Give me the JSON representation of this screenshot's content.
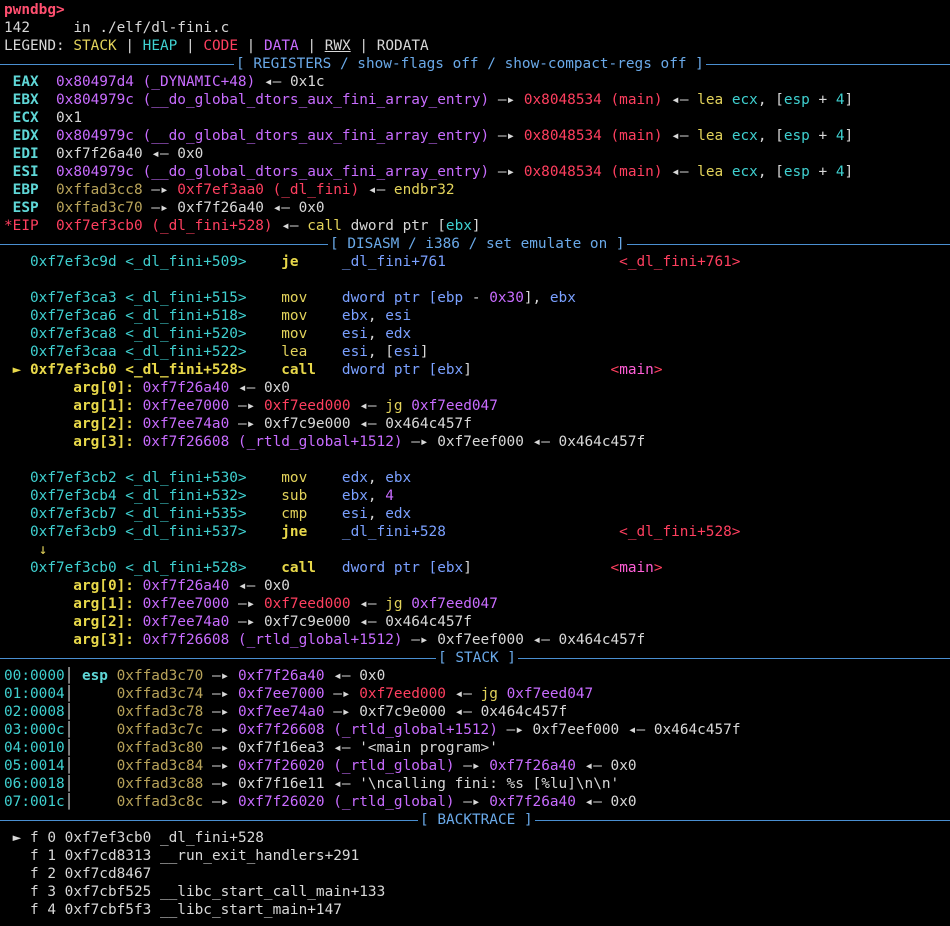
{
  "prompt": "pwndbg>",
  "source_line": {
    "num": "142",
    "text": "in ./elf/dl-fini.c"
  },
  "legend": {
    "label": "LEGEND:",
    "items": [
      {
        "text": "STACK",
        "color": "#e3d35b"
      },
      {
        "text": "HEAP",
        "color": "#3fd0d0"
      },
      {
        "text": "CODE",
        "color": "#ff3f5f"
      },
      {
        "text": "DATA",
        "color": "#c86cff"
      },
      {
        "text": "RWX",
        "color": "#d8d8d8"
      },
      {
        "text": "RODATA",
        "color": "#d8d8d8"
      }
    ]
  },
  "sections": {
    "registers": "[ REGISTERS / show-flags off / show-compact-regs off ]",
    "disasm": "[ DISASM / i386 / set emulate on ]",
    "stack": "[ STACK ]",
    "backtrace": "[ BACKTRACE ]"
  },
  "registers": [
    [
      {
        "t": " EAX ",
        "c": "reg"
      },
      {
        "t": " 0x80497d4 (_DYNAMIC+48) ",
        "c": "purple"
      },
      {
        "t": "◂— ",
        "c": "white"
      },
      {
        "t": "0x1c",
        "c": "white"
      }
    ],
    [
      {
        "t": " EBX ",
        "c": "reg"
      },
      {
        "t": " 0x804979c (__do_global_dtors_aux_fini_array_entry) ",
        "c": "purple"
      },
      {
        "t": "—▸ ",
        "c": "white"
      },
      {
        "t": "0x8048534 (main) ",
        "c": "red"
      },
      {
        "t": "◂— ",
        "c": "white"
      },
      {
        "t": "lea ",
        "c": "yellow"
      },
      {
        "t": "ecx",
        "c": "cyan"
      },
      {
        "t": ", [",
        "c": "white"
      },
      {
        "t": "esp",
        "c": "cyan"
      },
      {
        "t": " + ",
        "c": "white"
      },
      {
        "t": "4",
        "c": "cyan"
      },
      {
        "t": "]",
        "c": "white"
      }
    ],
    [
      {
        "t": " ECX ",
        "c": "reg"
      },
      {
        "t": " 0x1",
        "c": "white"
      }
    ],
    [
      {
        "t": " EDX ",
        "c": "reg"
      },
      {
        "t": " 0x804979c (__do_global_dtors_aux_fini_array_entry) ",
        "c": "purple"
      },
      {
        "t": "—▸ ",
        "c": "white"
      },
      {
        "t": "0x8048534 (main) ",
        "c": "red"
      },
      {
        "t": "◂— ",
        "c": "white"
      },
      {
        "t": "lea ",
        "c": "yellow"
      },
      {
        "t": "ecx",
        "c": "cyan"
      },
      {
        "t": ", [",
        "c": "white"
      },
      {
        "t": "esp",
        "c": "cyan"
      },
      {
        "t": " + ",
        "c": "white"
      },
      {
        "t": "4",
        "c": "cyan"
      },
      {
        "t": "]",
        "c": "white"
      }
    ],
    [
      {
        "t": " EDI ",
        "c": "reg"
      },
      {
        "t": " 0xf7f26a40 ",
        "c": "white"
      },
      {
        "t": "◂— ",
        "c": "white"
      },
      {
        "t": "0x0",
        "c": "white"
      }
    ],
    [
      {
        "t": " ESI ",
        "c": "reg"
      },
      {
        "t": " 0x804979c (__do_global_dtors_aux_fini_array_entry) ",
        "c": "purple"
      },
      {
        "t": "—▸ ",
        "c": "white"
      },
      {
        "t": "0x8048534 (main) ",
        "c": "red"
      },
      {
        "t": "◂— ",
        "c": "white"
      },
      {
        "t": "lea ",
        "c": "yellow"
      },
      {
        "t": "ecx",
        "c": "cyan"
      },
      {
        "t": ", [",
        "c": "white"
      },
      {
        "t": "esp",
        "c": "cyan"
      },
      {
        "t": " + ",
        "c": "white"
      },
      {
        "t": "4",
        "c": "cyan"
      },
      {
        "t": "]",
        "c": "white"
      }
    ],
    [
      {
        "t": " EBP ",
        "c": "reg"
      },
      {
        "t": " 0xffad3cc8 ",
        "c": "brown"
      },
      {
        "t": "—▸ ",
        "c": "white"
      },
      {
        "t": "0xf7ef3aa0 (_dl_fini) ",
        "c": "red"
      },
      {
        "t": "◂— ",
        "c": "white"
      },
      {
        "t": "endbr32",
        "c": "yellow"
      }
    ],
    [
      {
        "t": " ESP ",
        "c": "reg"
      },
      {
        "t": " 0xffad3c70 ",
        "c": "brown"
      },
      {
        "t": "—▸ ",
        "c": "white"
      },
      {
        "t": "0xf7f26a40 ",
        "c": "white"
      },
      {
        "t": "◂— ",
        "c": "white"
      },
      {
        "t": "0x0",
        "c": "white"
      }
    ],
    [
      {
        "t": "*EIP ",
        "c": "red"
      },
      {
        "t": " 0xf7ef3cb0 (_dl_fini+528) ",
        "c": "red"
      },
      {
        "t": "◂— ",
        "c": "white"
      },
      {
        "t": "call ",
        "c": "yellow"
      },
      {
        "t": "dword ptr [",
        "c": "white"
      },
      {
        "t": "ebx",
        "c": "cyan"
      },
      {
        "t": "]",
        "c": "white"
      }
    ]
  ],
  "disasm": [
    [
      {
        "t": "   0xf7ef3c9d <_dl_fini+509>    ",
        "c": "cyan"
      },
      {
        "t": "je     ",
        "c": "ybold"
      },
      {
        "t": "_dl_fini+761",
        "c": "blue"
      },
      {
        "t": "                    ",
        "c": "white"
      },
      {
        "t": "<_dl_fini+761>",
        "c": "red"
      }
    ],
    [],
    [
      {
        "t": "   0xf7ef3ca3 <_dl_fini+515>    ",
        "c": "cyan"
      },
      {
        "t": "mov    ",
        "c": "yellow"
      },
      {
        "t": "dword ptr [",
        "c": "blue"
      },
      {
        "t": "ebp",
        "c": "blue"
      },
      {
        "t": " - ",
        "c": "white"
      },
      {
        "t": "0x30",
        "c": "purple"
      },
      {
        "t": "], ",
        "c": "white"
      },
      {
        "t": "ebx",
        "c": "blue"
      }
    ],
    [
      {
        "t": "   0xf7ef3ca6 <_dl_fini+518>    ",
        "c": "cyan"
      },
      {
        "t": "mov    ",
        "c": "yellow"
      },
      {
        "t": "ebx",
        "c": "blue"
      },
      {
        "t": ", ",
        "c": "white"
      },
      {
        "t": "esi",
        "c": "blue"
      }
    ],
    [
      {
        "t": "   0xf7ef3ca8 <_dl_fini+520>    ",
        "c": "cyan"
      },
      {
        "t": "mov    ",
        "c": "yellow"
      },
      {
        "t": "esi",
        "c": "blue"
      },
      {
        "t": ", ",
        "c": "white"
      },
      {
        "t": "edx",
        "c": "blue"
      }
    ],
    [
      {
        "t": "   0xf7ef3caa <_dl_fini+522>    ",
        "c": "cyan"
      },
      {
        "t": "lea    ",
        "c": "yellow"
      },
      {
        "t": "esi",
        "c": "blue"
      },
      {
        "t": ", [",
        "c": "white"
      },
      {
        "t": "esi",
        "c": "blue"
      },
      {
        "t": "]",
        "c": "white"
      }
    ],
    [
      {
        "t": " ► 0xf7ef3cb0 <_dl_fini+528>    ",
        "c": "ybold"
      },
      {
        "t": "call   ",
        "c": "ybold"
      },
      {
        "t": "dword ptr [",
        "c": "blue"
      },
      {
        "t": "ebx",
        "c": "blue"
      },
      {
        "t": "]",
        "c": "white"
      },
      {
        "t": "                ",
        "c": "white"
      },
      {
        "t": "<",
        "c": "red"
      },
      {
        "t": "main",
        "c": "magenta"
      },
      {
        "t": ">",
        "c": "red"
      }
    ],
    [
      {
        "t": "        arg[0]: ",
        "c": "ybold"
      },
      {
        "t": "0xf7f26a40 ",
        "c": "purple"
      },
      {
        "t": "◂— ",
        "c": "white"
      },
      {
        "t": "0x0",
        "c": "white"
      }
    ],
    [
      {
        "t": "        arg[1]: ",
        "c": "ybold"
      },
      {
        "t": "0xf7ee7000 ",
        "c": "purple"
      },
      {
        "t": "—▸ ",
        "c": "white"
      },
      {
        "t": "0xf7eed000 ",
        "c": "red"
      },
      {
        "t": "◂— ",
        "c": "white"
      },
      {
        "t": "jg ",
        "c": "yellow"
      },
      {
        "t": "0xf7eed047",
        "c": "purple"
      }
    ],
    [
      {
        "t": "        arg[2]: ",
        "c": "ybold"
      },
      {
        "t": "0xf7ee74a0 ",
        "c": "purple"
      },
      {
        "t": "—▸ ",
        "c": "white"
      },
      {
        "t": "0xf7c9e000 ",
        "c": "white"
      },
      {
        "t": "◂— ",
        "c": "white"
      },
      {
        "t": "0x464c457f",
        "c": "white"
      }
    ],
    [
      {
        "t": "        arg[3]: ",
        "c": "ybold"
      },
      {
        "t": "0xf7f26608 (_rtld_global+1512) ",
        "c": "purple"
      },
      {
        "t": "—▸ ",
        "c": "white"
      },
      {
        "t": "0xf7eef000 ",
        "c": "white"
      },
      {
        "t": "◂— ",
        "c": "white"
      },
      {
        "t": "0x464c457f",
        "c": "white"
      }
    ],
    [],
    [
      {
        "t": "   0xf7ef3cb2 <_dl_fini+530>    ",
        "c": "cyan"
      },
      {
        "t": "mov    ",
        "c": "yellow"
      },
      {
        "t": "edx",
        "c": "blue"
      },
      {
        "t": ", ",
        "c": "white"
      },
      {
        "t": "ebx",
        "c": "blue"
      }
    ],
    [
      {
        "t": "   0xf7ef3cb4 <_dl_fini+532>    ",
        "c": "cyan"
      },
      {
        "t": "sub    ",
        "c": "yellow"
      },
      {
        "t": "ebx",
        "c": "blue"
      },
      {
        "t": ", ",
        "c": "white"
      },
      {
        "t": "4",
        "c": "purple"
      }
    ],
    [
      {
        "t": "   0xf7ef3cb7 <_dl_fini+535>    ",
        "c": "cyan"
      },
      {
        "t": "cmp    ",
        "c": "yellow"
      },
      {
        "t": "esi",
        "c": "blue"
      },
      {
        "t": ", ",
        "c": "white"
      },
      {
        "t": "edx",
        "c": "blue"
      }
    ],
    [
      {
        "t": "   0xf7ef3cb9 <_dl_fini+537>    ",
        "c": "cyan"
      },
      {
        "t": "jne    ",
        "c": "ybold"
      },
      {
        "t": "_dl_fini+528",
        "c": "blue"
      },
      {
        "t": "                    ",
        "c": "white"
      },
      {
        "t": "<_dl_fini+528>",
        "c": "red"
      }
    ],
    [
      {
        "t": "    ↓",
        "c": "yellow"
      }
    ],
    [
      {
        "t": "   0xf7ef3cb0 <_dl_fini+528>    ",
        "c": "cyan"
      },
      {
        "t": "call   ",
        "c": "ybold"
      },
      {
        "t": "dword ptr [",
        "c": "blue"
      },
      {
        "t": "ebx",
        "c": "blue"
      },
      {
        "t": "]",
        "c": "white"
      },
      {
        "t": "                ",
        "c": "white"
      },
      {
        "t": "<",
        "c": "red"
      },
      {
        "t": "main",
        "c": "magenta"
      },
      {
        "t": ">",
        "c": "red"
      }
    ],
    [
      {
        "t": "        arg[0]: ",
        "c": "ybold"
      },
      {
        "t": "0xf7f26a40 ",
        "c": "purple"
      },
      {
        "t": "◂— ",
        "c": "white"
      },
      {
        "t": "0x0",
        "c": "white"
      }
    ],
    [
      {
        "t": "        arg[1]: ",
        "c": "ybold"
      },
      {
        "t": "0xf7ee7000 ",
        "c": "purple"
      },
      {
        "t": "—▸ ",
        "c": "white"
      },
      {
        "t": "0xf7eed000 ",
        "c": "red"
      },
      {
        "t": "◂— ",
        "c": "white"
      },
      {
        "t": "jg ",
        "c": "yellow"
      },
      {
        "t": "0xf7eed047",
        "c": "purple"
      }
    ],
    [
      {
        "t": "        arg[2]: ",
        "c": "ybold"
      },
      {
        "t": "0xf7ee74a0 ",
        "c": "purple"
      },
      {
        "t": "—▸ ",
        "c": "white"
      },
      {
        "t": "0xf7c9e000 ",
        "c": "white"
      },
      {
        "t": "◂— ",
        "c": "white"
      },
      {
        "t": "0x464c457f",
        "c": "white"
      }
    ],
    [
      {
        "t": "        arg[3]: ",
        "c": "ybold"
      },
      {
        "t": "0xf7f26608 (_rtld_global+1512) ",
        "c": "purple"
      },
      {
        "t": "—▸ ",
        "c": "white"
      },
      {
        "t": "0xf7eef000 ",
        "c": "white"
      },
      {
        "t": "◂— ",
        "c": "white"
      },
      {
        "t": "0x464c457f",
        "c": "white"
      }
    ]
  ],
  "stack": [
    [
      {
        "t": "00:0000",
        "c": "cyan"
      },
      {
        "t": "│ ",
        "c": "white"
      },
      {
        "t": "esp ",
        "c": "reg"
      },
      {
        "t": "0xffad3c70 ",
        "c": "brown"
      },
      {
        "t": "—▸ ",
        "c": "white"
      },
      {
        "t": "0xf7f26a40 ",
        "c": "purple"
      },
      {
        "t": "◂— ",
        "c": "white"
      },
      {
        "t": "0x0",
        "c": "white"
      }
    ],
    [
      {
        "t": "01:0004",
        "c": "cyan"
      },
      {
        "t": "│     ",
        "c": "white"
      },
      {
        "t": "0xffad3c74 ",
        "c": "brown"
      },
      {
        "t": "—▸ ",
        "c": "white"
      },
      {
        "t": "0xf7ee7000 ",
        "c": "purple"
      },
      {
        "t": "—▸ ",
        "c": "white"
      },
      {
        "t": "0xf7eed000 ",
        "c": "red"
      },
      {
        "t": "◂— ",
        "c": "white"
      },
      {
        "t": "jg ",
        "c": "yellow"
      },
      {
        "t": "0xf7eed047",
        "c": "purple"
      }
    ],
    [
      {
        "t": "02:0008",
        "c": "cyan"
      },
      {
        "t": "│     ",
        "c": "white"
      },
      {
        "t": "0xffad3c78 ",
        "c": "brown"
      },
      {
        "t": "—▸ ",
        "c": "white"
      },
      {
        "t": "0xf7ee74a0 ",
        "c": "purple"
      },
      {
        "t": "—▸ ",
        "c": "white"
      },
      {
        "t": "0xf7c9e000 ",
        "c": "white"
      },
      {
        "t": "◂— ",
        "c": "white"
      },
      {
        "t": "0x464c457f",
        "c": "white"
      }
    ],
    [
      {
        "t": "03:000c",
        "c": "cyan"
      },
      {
        "t": "│     ",
        "c": "white"
      },
      {
        "t": "0xffad3c7c ",
        "c": "brown"
      },
      {
        "t": "—▸ ",
        "c": "white"
      },
      {
        "t": "0xf7f26608 (_rtld_global+1512) ",
        "c": "purple"
      },
      {
        "t": "—▸ ",
        "c": "white"
      },
      {
        "t": "0xf7eef000 ",
        "c": "white"
      },
      {
        "t": "◂— ",
        "c": "white"
      },
      {
        "t": "0x464c457f",
        "c": "white"
      }
    ],
    [
      {
        "t": "04:0010",
        "c": "cyan"
      },
      {
        "t": "│     ",
        "c": "white"
      },
      {
        "t": "0xffad3c80 ",
        "c": "brown"
      },
      {
        "t": "—▸ ",
        "c": "white"
      },
      {
        "t": "0xf7f16ea3 ",
        "c": "white"
      },
      {
        "t": "◂— ",
        "c": "white"
      },
      {
        "t": "'<main program>'",
        "c": "white"
      }
    ],
    [
      {
        "t": "05:0014",
        "c": "cyan"
      },
      {
        "t": "│     ",
        "c": "white"
      },
      {
        "t": "0xffad3c84 ",
        "c": "brown"
      },
      {
        "t": "—▸ ",
        "c": "white"
      },
      {
        "t": "0xf7f26020 (_rtld_global) ",
        "c": "purple"
      },
      {
        "t": "—▸ ",
        "c": "white"
      },
      {
        "t": "0xf7f26a40 ",
        "c": "purple"
      },
      {
        "t": "◂— ",
        "c": "white"
      },
      {
        "t": "0x0",
        "c": "white"
      }
    ],
    [
      {
        "t": "06:0018",
        "c": "cyan"
      },
      {
        "t": "│     ",
        "c": "white"
      },
      {
        "t": "0xffad3c88 ",
        "c": "brown"
      },
      {
        "t": "—▸ ",
        "c": "white"
      },
      {
        "t": "0xf7f16e11 ",
        "c": "white"
      },
      {
        "t": "◂— ",
        "c": "white"
      },
      {
        "t": "'\\ncalling fini: %s [%lu]\\n\\n'",
        "c": "white"
      }
    ],
    [
      {
        "t": "07:001c",
        "c": "cyan"
      },
      {
        "t": "│     ",
        "c": "white"
      },
      {
        "t": "0xffad3c8c ",
        "c": "brown"
      },
      {
        "t": "—▸ ",
        "c": "white"
      },
      {
        "t": "0xf7f26020 (_rtld_global) ",
        "c": "purple"
      },
      {
        "t": "—▸ ",
        "c": "white"
      },
      {
        "t": "0xf7f26a40 ",
        "c": "purple"
      },
      {
        "t": "◂— ",
        "c": "white"
      },
      {
        "t": "0x0",
        "c": "white"
      }
    ]
  ],
  "backtrace": [
    [
      {
        "t": " ► f 0 ",
        "c": "white"
      },
      {
        "t": "0xf7ef3cb0 ",
        "c": "white"
      },
      {
        "t": "_dl_fini+528",
        "c": "white"
      }
    ],
    [
      {
        "t": "   f 1 ",
        "c": "white"
      },
      {
        "t": "0xf7cd8313 ",
        "c": "white"
      },
      {
        "t": "__run_exit_handlers+291",
        "c": "white"
      }
    ],
    [
      {
        "t": "   f 2 ",
        "c": "white"
      },
      {
        "t": "0xf7cd8467",
        "c": "white"
      }
    ],
    [
      {
        "t": "   f 3 ",
        "c": "white"
      },
      {
        "t": "0xf7cbf525 ",
        "c": "white"
      },
      {
        "t": "__libc_start_call_main+133",
        "c": "white"
      }
    ],
    [
      {
        "t": "   f 4 ",
        "c": "white"
      },
      {
        "t": "0xf7cbf5f3 ",
        "c": "white"
      },
      {
        "t": "__libc_start_main+147",
        "c": "white"
      }
    ]
  ]
}
